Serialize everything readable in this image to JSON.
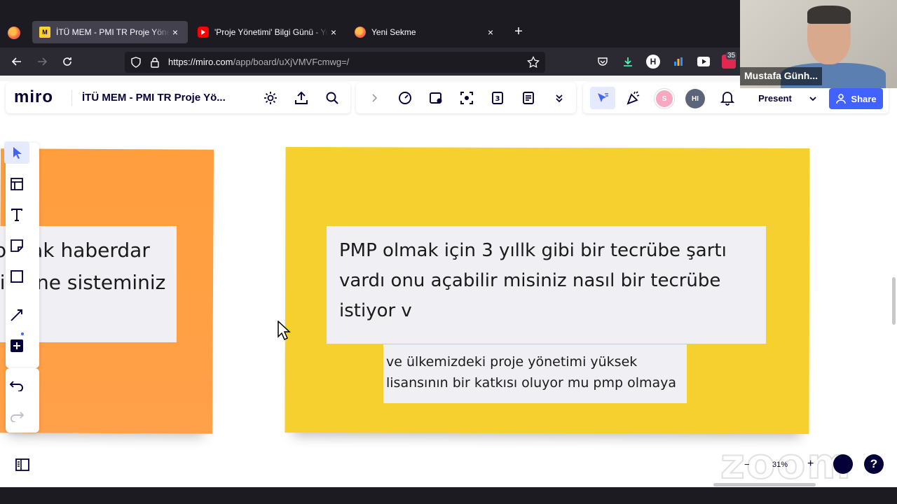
{
  "browser": {
    "tabs": [
      {
        "title": "İTÜ MEM - PMI TR Proje Yönetim",
        "favicon": "miro-icon",
        "active": true
      },
      {
        "title": "'Proje Yönetimi' Bilgi Günü - You",
        "favicon": "youtube-icon",
        "active": false
      },
      {
        "title": "Yeni Sekme",
        "favicon": "firefox-icon",
        "active": false
      }
    ],
    "url_host": "https://miro.com",
    "url_path": "/app/board/uXjVMVFcmwg=/",
    "badge_count": "35"
  },
  "miro": {
    "logo": "miro",
    "board_title": "İTÜ MEM - PMI TR Proje Yö...",
    "present_label": "Present",
    "share_label": "Share",
    "avatar_s": "S",
    "avatar_hi": "HI"
  },
  "canvas": {
    "left_note_lines": [
      "olmak haberdar",
      "limene sisteminiz"
    ],
    "main_note_lines": [
      "PMP olmak için 3 yıllk gibi bir tecrübe şartı",
      "vardı  onu açabilir misiniz nasıl bir tecrübe",
      "istiyor v"
    ],
    "sub_note_lines": [
      "ve ülkemizdeki proje yönetimi yüksek",
      "lisansının bir katkısı oluyor mu pmp olmaya"
    ]
  },
  "zoom": {
    "level": "31%",
    "watermark": "zoom"
  },
  "webcam": {
    "name": "Mustafa Günh..."
  },
  "colors": {
    "accent": "#4262ff",
    "sticky_yellow": "#f5d02f",
    "sticky_orange": "#ff9e3d"
  }
}
